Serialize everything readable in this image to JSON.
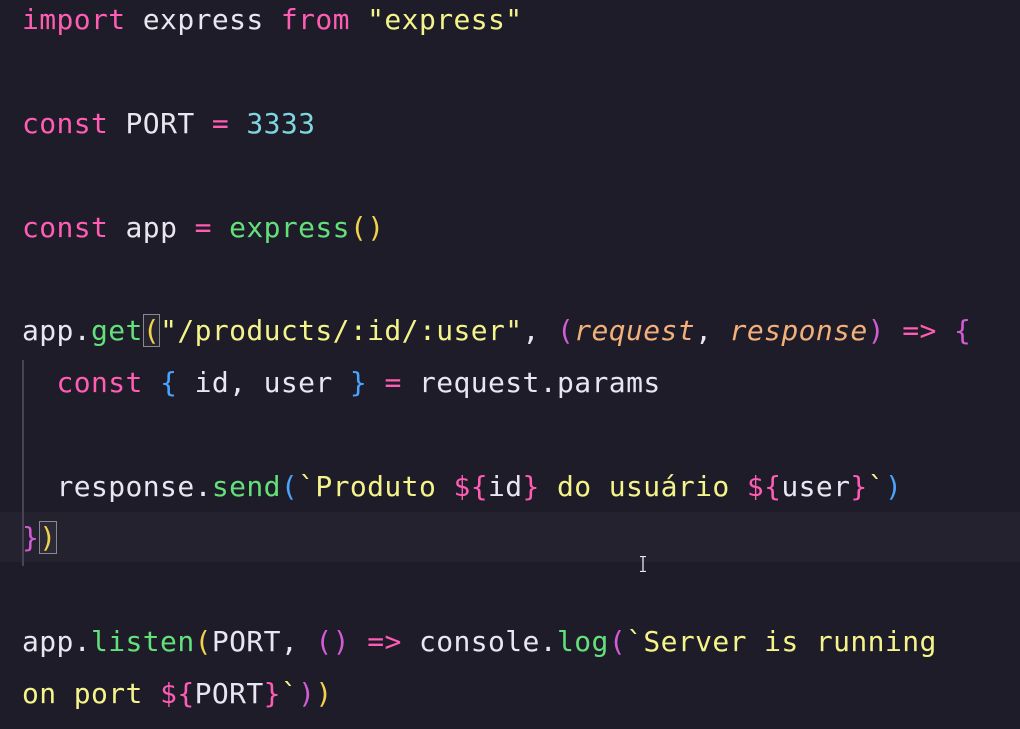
{
  "code": {
    "l1": {
      "kw_import": "import",
      "name": " express ",
      "kw_from": "from",
      "sp": " ",
      "str": "\"express\""
    },
    "l2": {
      "kw_const": "const",
      "name": " PORT ",
      "eq": "=",
      "sp": " ",
      "num": "3333"
    },
    "l3": {
      "kw_const": "const",
      "name": " app ",
      "eq": "=",
      "sp": " ",
      "fn": "express",
      "open": "(",
      "close": ")"
    },
    "l4": {
      "obj": "app.",
      "fn": "get",
      "open": "(",
      "str": "\"/products/:id/:user\"",
      "comma": ", ",
      "p_open": "(",
      "p1": "request",
      "p_comma": ", ",
      "p2": "response",
      "p_close": ")",
      "sp": " ",
      "arrow": "=>",
      "sp2": " ",
      "brace": "{"
    },
    "l5": {
      "indent": "  ",
      "kw_const": "const",
      "sp": " ",
      "b_open": "{",
      "vars": " id, user ",
      "b_close": "}",
      "sp2": " ",
      "eq": "=",
      "rest": " request.params"
    },
    "l6": {
      "indent": "  ",
      "obj": "response.",
      "fn": "send",
      "open": "(",
      "tmpl1": "`Produto ",
      "d1": "${",
      "v1": "id",
      "d1c": "}",
      "tmpl2": " do usuário ",
      "d2": "${",
      "v2": "user",
      "d2c": "}",
      "tmpl3": "`",
      "close": ")"
    },
    "l7": {
      "brace": "}",
      "paren": ")"
    },
    "l8": {
      "obj": "app.",
      "fn": "listen",
      "open": "(",
      "arg": "PORT, ",
      "a_open": "(",
      "a_close": ")",
      "sp": " ",
      "arrow": "=>",
      "rest": " console.",
      "fn2": "log",
      "open2": "(",
      "str": "`Server is running"
    },
    "l9": {
      "str": "on port ",
      "d": "${",
      "v": "PORT",
      "dc": "}",
      "tick": "`",
      "close2": ")",
      "close1": ")"
    }
  },
  "icons": {
    "cursor": "text-cursor-icon"
  },
  "colors": {
    "background": "#1e1c28",
    "keyword": "#ff5cb4",
    "string": "#f4f48a",
    "number": "#7ed6df",
    "function": "#64e07a",
    "parameter": "#f3b07a"
  }
}
